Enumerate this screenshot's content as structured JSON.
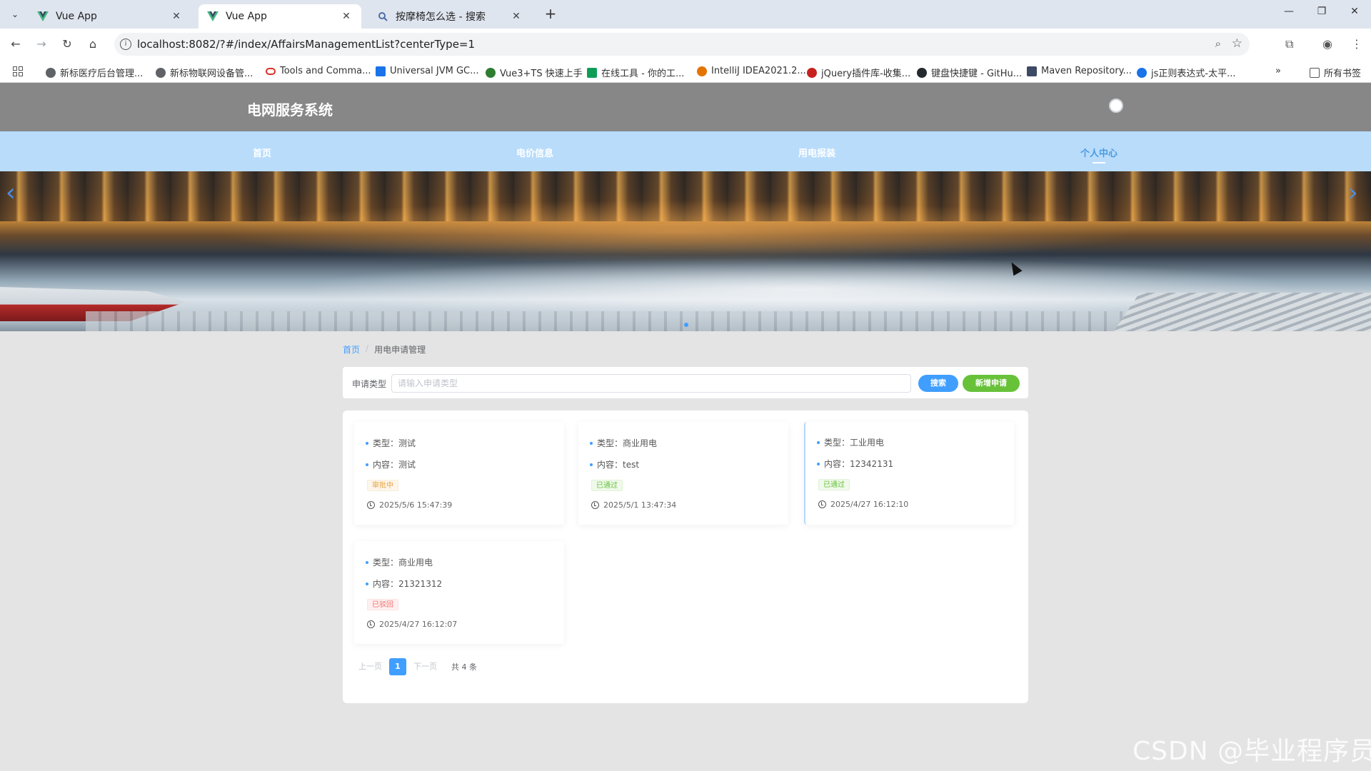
{
  "browser": {
    "tabs": [
      {
        "title": "Vue App",
        "active": false
      },
      {
        "title": "Vue App",
        "active": true
      },
      {
        "title": "按摩椅怎么选 - 搜索",
        "active": false
      }
    ],
    "url": "localhost:8082/?#/index/AffairsManagementList?centerType=1",
    "bookmarks": [
      "新标医疗后台管理...",
      "新标物联网设备管...",
      "Tools and Comma...",
      "Universal JVM GC...",
      "Vue3+TS 快速上手",
      "在线工具 - 你的工...",
      "IntelliJ IDEA2021.2...",
      "jQuery插件库-收集...",
      "键盘快捷键 - GitHu...",
      "Maven Repository...",
      "js正则表达式-太平..."
    ],
    "all_bookmarks": "所有书签"
  },
  "site": {
    "title": "电网服务系统",
    "nav": [
      {
        "label": "首页",
        "active": false
      },
      {
        "label": "电价信息",
        "active": false
      },
      {
        "label": "用电报装",
        "active": false
      },
      {
        "label": "个人中心",
        "active": true
      }
    ]
  },
  "breadcrumb": {
    "home": "首页",
    "separator": "/",
    "current": "用电申请管理"
  },
  "search": {
    "label": "申请类型",
    "placeholder": "请输入申请类型",
    "search_button": "搜索",
    "add_button": "新增申请"
  },
  "items": [
    {
      "type_label": "类型：",
      "type": "测试",
      "content_label": "内容：",
      "content": "测试",
      "status": "审批中",
      "time": "2025/5/6 15:47:39"
    },
    {
      "type_label": "类型：",
      "type": "商业用电",
      "content_label": "内容：",
      "content": "test",
      "status": "已通过",
      "time": "2025/5/1 13:47:34"
    },
    {
      "type_label": "类型：",
      "type": "工业用电",
      "content_label": "内容：",
      "content": "12342131",
      "status": "已通过",
      "time": "2025/4/27 16:12:10"
    },
    {
      "type_label": "类型：",
      "type": "商业用电",
      "content_label": "内容：",
      "content": "21321312",
      "status": "已驳回",
      "time": "2025/4/27 16:12:07"
    }
  ],
  "pagination": {
    "prev": "上一页",
    "page": "1",
    "next": "下一页",
    "total": "共 4 条"
  },
  "watermark": "CSDN @毕业程序员",
  "colors": {
    "primary": "#409eff",
    "success": "#67c23a",
    "warning": "#e6a23c",
    "danger": "#f56c6c",
    "header": "#878787",
    "nav": "#b9dcfb"
  }
}
